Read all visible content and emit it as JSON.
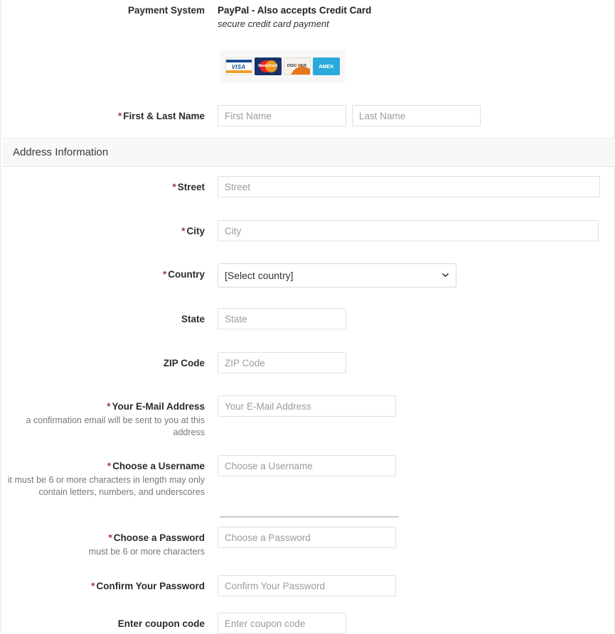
{
  "payment": {
    "label": "Payment System",
    "name": "PayPal - Also accepts Credit Card",
    "description": "secure credit card payment",
    "cards": [
      {
        "name": "visa-card-logo",
        "text": "VISA"
      },
      {
        "name": "mastercard-card-logo",
        "text": "MasterCard"
      },
      {
        "name": "discover-card-logo",
        "text": "DISC VER"
      },
      {
        "name": "amex-card-logo",
        "text": "AMEX"
      }
    ]
  },
  "name_row": {
    "label": "First & Last Name",
    "required": true,
    "first_placeholder": "First Name",
    "first_value": "",
    "last_placeholder": "Last Name",
    "last_value": ""
  },
  "section": {
    "title": "Address Information"
  },
  "fields": {
    "street": {
      "label": "Street",
      "required": true,
      "placeholder": "Street",
      "value": ""
    },
    "city": {
      "label": "City",
      "required": true,
      "placeholder": "City",
      "value": ""
    },
    "country": {
      "label": "Country",
      "required": true,
      "selected": "[Select country]",
      "options": [
        "[Select country]"
      ]
    },
    "state": {
      "label": "State",
      "required": false,
      "placeholder": "State",
      "value": ""
    },
    "zip": {
      "label": "ZIP Code",
      "required": false,
      "placeholder": "ZIP Code",
      "value": ""
    },
    "email": {
      "label": "Your E-Mail Address",
      "required": true,
      "help": "a confirmation email will be sent to you at this address",
      "placeholder": "Your E-Mail Address",
      "value": ""
    },
    "username": {
      "label": "Choose a Username",
      "required": true,
      "help": "it must be 6 or more characters in length may only contain letters, numbers, and underscores",
      "placeholder": "Choose a Username",
      "value": ""
    },
    "password": {
      "label": "Choose a Password",
      "required": true,
      "help": "must be 6 or more characters",
      "placeholder": "Choose a Password",
      "value": ""
    },
    "confirm_password": {
      "label": "Confirm Your Password",
      "required": true,
      "placeholder": "Confirm Your Password",
      "value": ""
    },
    "coupon": {
      "label": "Enter coupon code",
      "required": false,
      "placeholder": "Enter coupon code",
      "value": ""
    }
  },
  "colors": {
    "required_star": "#9e3b3b",
    "section_bg": "#f8f8f8",
    "input_border": "#e0e0e0",
    "placeholder": "#9b9b9b"
  }
}
